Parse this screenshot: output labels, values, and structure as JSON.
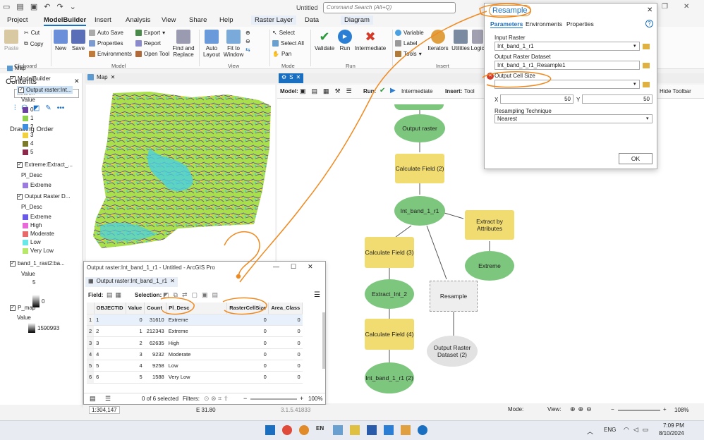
{
  "title_bar": {
    "doc_title": "Untitled",
    "search_placeholder": "Command Search (Alt+Q)"
  },
  "tabs": [
    "Project",
    "ModelBuilder",
    "Insert",
    "Analysis",
    "View",
    "Share",
    "Help",
    "Raster Layer",
    "Data",
    "Diagram"
  ],
  "ribbon": {
    "clipboard": {
      "paste": "Paste",
      "cut": "Cut",
      "copy": "Copy",
      "group": "Clipboard"
    },
    "model": {
      "new": "New",
      "save": "Save",
      "auto_save": "Auto Save",
      "properties": "Properties",
      "environments": "Environments",
      "export": "Export",
      "report": "Report",
      "open_tool": "Open Tool",
      "find_replace": "Find and Replace",
      "group": "Model"
    },
    "view": {
      "auto_layout": "Auto Layout",
      "fit_window": "Fit to Window",
      "group": "View"
    },
    "mode": {
      "select": "Select",
      "select_all": "Select All",
      "pan": "Pan",
      "group": "Mode"
    },
    "run": {
      "validate": "Validate",
      "run": "Run",
      "intermediate": "Intermediate",
      "group": "Run"
    },
    "insert": {
      "variable": "Variable",
      "label": "Label",
      "tools": "Tools",
      "iterators": "Iterators",
      "utilities": "Utilities",
      "logic": "Logic",
      "group": "Insert"
    }
  },
  "contents": {
    "title": "Contents",
    "search_placeholder": "Search",
    "drawing_order": "Drawing Order",
    "items": [
      {
        "label": "Map"
      },
      {
        "label": "ModelBuilder"
      },
      {
        "label": "Output raster:Int..."
      },
      {
        "label": "Value"
      },
      {
        "label": "0",
        "color": "#6b3fa0"
      },
      {
        "label": "1",
        "color": "#8fd14f"
      },
      {
        "label": "2",
        "color": "#3d8ee0"
      },
      {
        "label": "3",
        "color": "#f0d040"
      },
      {
        "label": "4",
        "color": "#7a7a2a"
      },
      {
        "label": "5",
        "color": "#8b2a4a"
      },
      {
        "label": "Extreme:Extract_..."
      },
      {
        "label": "Pl_Desc"
      },
      {
        "label": "Extreme",
        "color": "#9b7be0"
      },
      {
        "label": "Output Raster D..."
      },
      {
        "label": "Pl_Desc"
      },
      {
        "label": "Extreme",
        "color": "#6a5ae8"
      },
      {
        "label": "High",
        "color": "#e86ad8"
      },
      {
        "label": "Moderate",
        "color": "#e86a6a"
      },
      {
        "label": "Low",
        "color": "#6ae8e8"
      },
      {
        "label": "Very Low",
        "color": "#b8e86a"
      },
      {
        "label": "band_1_rast2:ba..."
      },
      {
        "label": "Value"
      },
      {
        "label": "5"
      },
      {
        "label": "0"
      },
      {
        "label": "P_map"
      },
      {
        "label": "Value"
      },
      {
        "label": "1590993"
      }
    ]
  },
  "doc_tabs": {
    "map": "Map",
    "model": "S"
  },
  "model_toolbar": {
    "model": "Model:",
    "run": "Run:",
    "intermediate": "Intermediate",
    "insert": "Insert:",
    "tool": "Tool",
    "hide": "Hide Toolbar"
  },
  "nodes": {
    "output_raster": "Output raster",
    "calc2": "Calculate Field (2)",
    "int_band": "Int_band_1_r1",
    "calc3": "Calculate Field (3)",
    "extract_attr": "Extract by Attributes",
    "extreme": "Extreme",
    "extract_int2": "Extract_Int_2",
    "resample": "Resample",
    "calc4": "Calculate Field (4)",
    "int_band2": "Int_band_1_r1 (2)",
    "output_dataset2": "Output Raster Dataset (2)"
  },
  "dialog": {
    "title": "Resample",
    "tabs": [
      "Parameters",
      "Environments",
      "Properties"
    ],
    "input_raster_label": "Input Raster",
    "input_raster": "Int_band_1_r1",
    "output_label": "Output Raster Dataset",
    "output": "Int_band_1_r1_Resample1",
    "cell_size_label": "Output Cell Size",
    "x_label": "X",
    "x": "50",
    "y_label": "Y",
    "y": "50",
    "technique_label": "Resampling Technique",
    "technique": "Nearest",
    "ok": "OK"
  },
  "table": {
    "title": "Output raster:Int_band_1_r1 - Untitled - ArcGIS Pro",
    "tab": "Output raster:Int_band_1_r1",
    "field": "Field:",
    "selection": "Selection:",
    "columns": [
      "OBJECTID",
      "Value",
      "Count",
      "Pl_Desc",
      "RasterCellSize",
      "Area_Class"
    ],
    "rows": [
      [
        "1",
        "0",
        "31610",
        "Extreme",
        "0",
        "0"
      ],
      [
        "2",
        "1",
        "212343",
        "Extreme",
        "0",
        "0"
      ],
      [
        "3",
        "2",
        "62635",
        "High",
        "0",
        "0"
      ],
      [
        "4",
        "3",
        "9232",
        "Moderate",
        "0",
        "0"
      ],
      [
        "5",
        "4",
        "9258",
        "Low",
        "0",
        "0"
      ],
      [
        "6",
        "5",
        "1588",
        "Very Low",
        "0",
        "0"
      ]
    ],
    "rownums": [
      "1",
      "2",
      "3",
      "4",
      "5",
      "6"
    ],
    "footer": "0 of 6 selected",
    "filters": "Filters:",
    "zoom": "100%"
  },
  "status": {
    "scale": "1:304,147",
    "coords": "E 31.80",
    "coords2": "3.1.5.41833",
    "mode": "Mode:",
    "view": "View:",
    "zoom": "108%"
  },
  "taskbar": {
    "lang": "ENG",
    "time": "7:09 PM",
    "date": "8/10/2024",
    "en": "EN"
  }
}
